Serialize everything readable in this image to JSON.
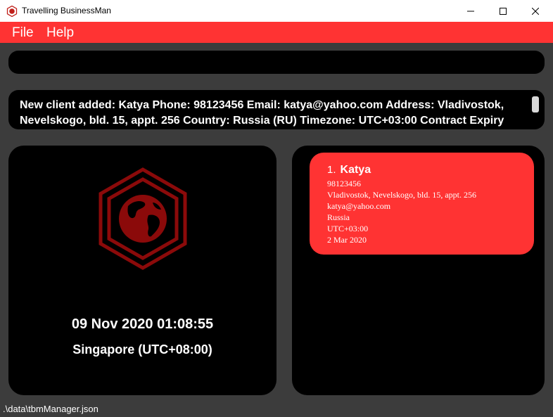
{
  "window": {
    "title": "Travelling BusinessMan",
    "controls": [
      "minimize",
      "maximize",
      "close"
    ]
  },
  "menu": {
    "items": [
      {
        "label": "File"
      },
      {
        "label": "Help"
      }
    ]
  },
  "command": {
    "value": ""
  },
  "result": {
    "text": "New client added: Katya Phone: 98123456 Email: katya@yahoo.com Address: Vladivostok, Nevelskogo, bld. 15, appt. 256 Country: Russia (RU) Timezone: UTC+03:00 Contract Expiry"
  },
  "clock": {
    "datetime": "09 Nov 2020 01:08:55",
    "timezone": "Singapore (UTC+08:00)",
    "logo_icon": "globe-hexagon-icon"
  },
  "clients": [
    {
      "index": "1.",
      "name": "Katya",
      "phone": "98123456",
      "address": "Vladivostok, Nevelskogo, bld. 15, appt. 256",
      "email": "katya@yahoo.com",
      "country": "Russia",
      "timezone": "UTC+03:00",
      "contract_expiry": "2 Mar 2020"
    }
  ],
  "status": {
    "file_path": ".\\data\\tbmManager.json"
  },
  "colors": {
    "accent": "#ff3333",
    "panel": "#000000",
    "background": "#3c3c3c",
    "logo": "#8b0a0a"
  }
}
